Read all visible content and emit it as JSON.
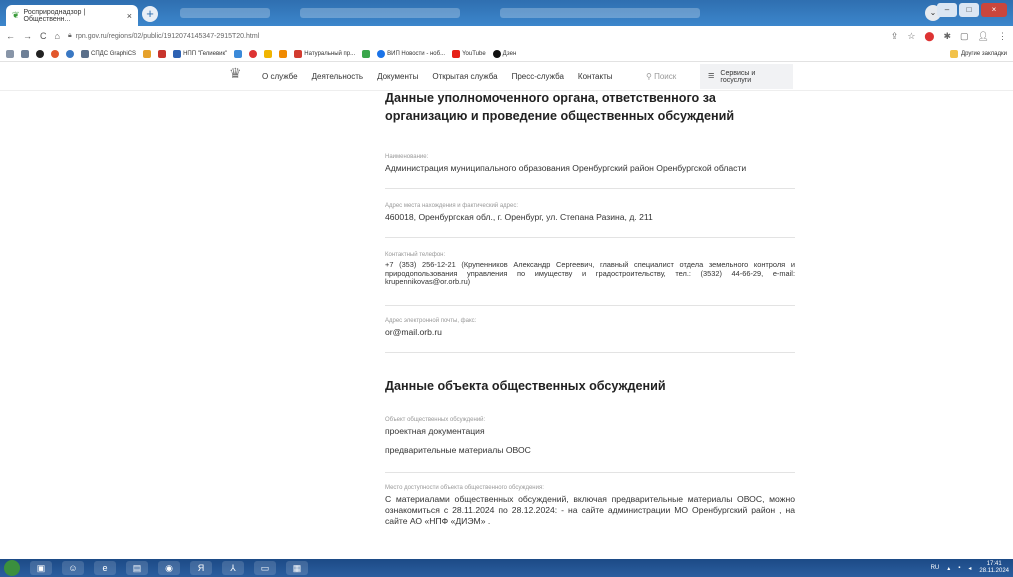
{
  "browser": {
    "tab_title": "Росприроднадзор | Общественн...",
    "tab_close": "×",
    "new_tab": "+",
    "url": "rpn.gov.ru/regions/02/public/1912074145347-2915T20.html",
    "win_min": "–",
    "win_max": "□",
    "win_close": "×"
  },
  "bookmarks": {
    "items": [
      {
        "label": "СПДС GraphiCS",
        "color": "#5a6f8a"
      },
      {
        "label": "НПП \"Гелиевик\"",
        "color": "#2d62b3"
      },
      {
        "label": "Натуральный пр...",
        "color": "#d23b2f"
      },
      {
        "label": "ВИП Новости - ноб...",
        "color": "#1a73e8"
      },
      {
        "label": "YouTube",
        "color": "#e62117"
      },
      {
        "label": "Дзен",
        "color": "#111111"
      }
    ],
    "other": "Другие закладки"
  },
  "site": {
    "nav": [
      "О службе",
      "Деятельность",
      "Документы",
      "Открытая служба",
      "Пресс-служба",
      "Контакты"
    ],
    "search": "Поиск",
    "services": "Сервисы и госуслуги"
  },
  "section1": {
    "title": "Данные уполномоченного органа, ответственного за организацию и проведение общественных обсуждений",
    "fields": [
      {
        "label": "Наименование:",
        "value": "Администрация муниципального образования Оренбургский район Оренбургской области"
      },
      {
        "label": "Адрес места нахождения и фактический адрес:",
        "value": "460018, Оренбургская обл., г. Оренбург, ул. Степана Разина, д. 211"
      },
      {
        "label": "Контактный телефон:",
        "value": "+7 (353) 256-12-21 (Крупенников Александр Сергеевич, главный специалист отдела земельного контроля и природопользования управления по имуществу и градостроительству, тел.: (3532) 44-66-29, e-mail: krupennikovas@or.orb.ru)"
      },
      {
        "label": "Адрес электронной почты, факс:",
        "value": "or@mail.orb.ru"
      }
    ]
  },
  "section2": {
    "title": "Данные объекта общественных обсуждений",
    "object_label": "Объект общественных обсуждений:",
    "object_values": [
      "проектная документация",
      "предварительные материалы ОВОС"
    ],
    "place_label": "Место доступности объекта общественного обсуждения:",
    "place_value": "С материалами общественных обсуждений, включая предварительные материалы ОВОС, можно ознакомиться с 28.11.2024 по 28.12.2024: - на сайте администрации МО Оренбургский район , на сайте АО «НПФ «ДИЭМ» ."
  },
  "taskbar": {
    "lang": "RU",
    "time": "17:41",
    "date": "28.11.2024"
  }
}
